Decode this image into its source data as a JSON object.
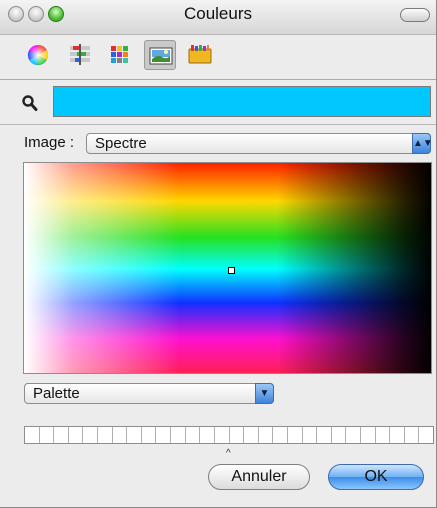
{
  "window": {
    "title": "Couleurs"
  },
  "toolbar": {
    "tools": [
      "color-wheel-icon",
      "color-sliders-icon",
      "color-palettes-icon",
      "image-palettes-icon",
      "crayons-icon"
    ],
    "selected": "image-palettes-icon"
  },
  "current_color": "#00c8ff",
  "image_selector": {
    "label": "Image :",
    "value": "Spectre"
  },
  "palette_selector": {
    "value": "Palette"
  },
  "buttons": {
    "cancel": "Annuler",
    "ok": "OK"
  }
}
